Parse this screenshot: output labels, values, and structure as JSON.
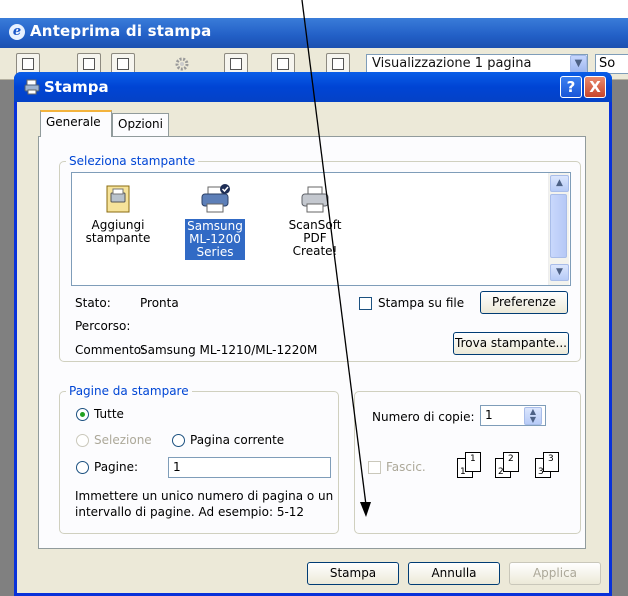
{
  "parent": {
    "title": "Anteprima di stampa",
    "view_select_value": "Visualizzazione 1 pagina",
    "partial_button": "So"
  },
  "dialog": {
    "title": "Stampa",
    "help_glyph": "?",
    "close_glyph": "X",
    "tabs": [
      {
        "label": "Generale",
        "active": true
      },
      {
        "label": "Opzioni",
        "active": false
      }
    ],
    "select_printer": {
      "legend": "Seleziona stampante",
      "printers": [
        {
          "name_line1": "Aggiungi",
          "name_line2": "stampante",
          "name_line3": "",
          "selected": false,
          "icon": "add-printer-icon"
        },
        {
          "name_line1": "Samsung",
          "name_line2": "ML-1200",
          "name_line3": "Series",
          "selected": true,
          "icon": "printer-default-icon"
        },
        {
          "name_line1": "ScanSoft PDF",
          "name_line2": "Create!",
          "name_line3": "",
          "selected": false,
          "icon": "printer-icon"
        }
      ],
      "status_label": "Stato:",
      "status_value": "Pronta",
      "path_label": "Percorso:",
      "path_value": "",
      "comment_label": "Commento:",
      "comment_value": "Samsung ML-1210/ML-1220M",
      "print_to_file_label": "Stampa su file",
      "print_to_file_checked": false,
      "preferences_button": "Preferenze",
      "find_printer_button": "Trova stampante..."
    },
    "page_range": {
      "legend": "Pagine da stampare",
      "all_label": "Tutte",
      "selection_label": "Selezione",
      "current_page_label": "Pagina corrente",
      "pages_label": "Pagine:",
      "pages_value": "1",
      "selected_option": "Tutte",
      "hint": [
        "Immettere un unico numero di pagina o un",
        "intervallo di pagine. Ad esempio: 5-12"
      ]
    },
    "copies": {
      "label": "Numero di copie:",
      "value": "1",
      "collate_label": "Fascic.",
      "collate_checked": false,
      "collate_pages": [
        "1",
        "1",
        "2",
        "2",
        "3",
        "3"
      ]
    },
    "buttons": {
      "print": "Stampa",
      "cancel": "Annulla",
      "apply": "Applica"
    }
  },
  "colors": {
    "titlebar_blue": "#0a5ee8",
    "dialog_bg": "#ece9d8",
    "legend_blue": "#0046d5",
    "selection_blue": "#316ac5",
    "radio_green": "#21a121"
  }
}
